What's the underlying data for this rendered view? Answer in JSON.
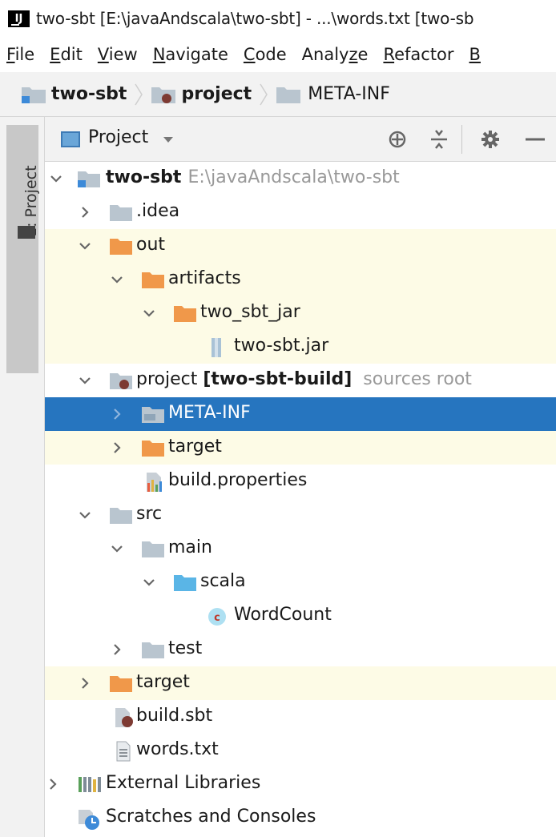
{
  "window": {
    "title": "two-sbt [E:\\javaAndscala\\two-sbt] - ...\\words.txt [two-sb"
  },
  "menubar": [
    {
      "u": "F",
      "rest": "ile"
    },
    {
      "u": "E",
      "rest": "dit"
    },
    {
      "u": "V",
      "rest": "iew"
    },
    {
      "u": "N",
      "rest": "avigate"
    },
    {
      "u": "C",
      "rest": "ode"
    },
    {
      "pre": "Analy",
      "u": "z",
      "rest": "e"
    },
    {
      "u": "R",
      "rest": "efactor"
    },
    {
      "u": "B",
      "rest": ""
    }
  ],
  "breadcrumb": [
    "two-sbt",
    "project",
    "META-INF"
  ],
  "side_tab": {
    "label": "1: Project"
  },
  "toolbar": {
    "view_label": "Project"
  },
  "tree": {
    "root": {
      "name": "two-sbt",
      "path": "E:\\javaAndscala\\two-sbt"
    },
    "idea": ".idea",
    "out": "out",
    "artifacts": "artifacts",
    "two_sbt_jar": "two_sbt_jar",
    "jar_file": "two-sbt.jar",
    "project": {
      "name": "project",
      "module": "[two-sbt-build]",
      "note": "sources root"
    },
    "meta_inf": "META-INF",
    "project_target": "target",
    "build_properties": "build.properties",
    "src": "src",
    "main": "main",
    "scala": "scala",
    "wordcount": "WordCount",
    "test": "test",
    "target": "target",
    "build_sbt": "build.sbt",
    "words_txt": "words.txt",
    "external_libraries": "External Libraries",
    "scratches": "Scratches and Consoles"
  },
  "colors": {
    "selection": "#2675bf",
    "excluded_highlight": "#fdfbe6",
    "excluded_folder": "#f0984a",
    "folder": "#b9c5cf",
    "source_folder": "#5ab5e6"
  }
}
